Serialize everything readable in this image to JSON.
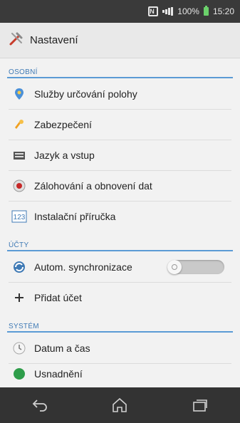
{
  "status_bar": {
    "nfc": "N",
    "battery_percent": "100%",
    "time": "15:20"
  },
  "action_bar": {
    "title": "Nastavení",
    "icon": "tools-icon"
  },
  "sections": [
    {
      "header": "OSOBNÍ",
      "items": [
        {
          "label": "Služby určování polohy",
          "icon": "location-icon"
        },
        {
          "label": "Zabezpečení",
          "icon": "lock-icon"
        },
        {
          "label": "Jazyk a vstup",
          "icon": "keyboard-icon"
        },
        {
          "label": "Zálohování a obnovení dat",
          "icon": "backup-icon"
        },
        {
          "label": "Instalační příručka",
          "icon": "guide-123-icon"
        }
      ]
    },
    {
      "header": "ÚČTY",
      "items": [
        {
          "label": "Autom. synchronizace",
          "icon": "sync-icon",
          "toggle": false
        },
        {
          "label": "Přidat účet",
          "icon": "plus-icon"
        }
      ]
    },
    {
      "header": "SYSTÉM",
      "items": [
        {
          "label": "Datum a čas",
          "icon": "clock-icon"
        },
        {
          "label": "Usnadnění",
          "icon": "accessibility-icon"
        }
      ]
    }
  ],
  "colors": {
    "accent": "#5b9bd5",
    "status_bar": "#3a3a3a",
    "nav_bar": "#333333"
  }
}
